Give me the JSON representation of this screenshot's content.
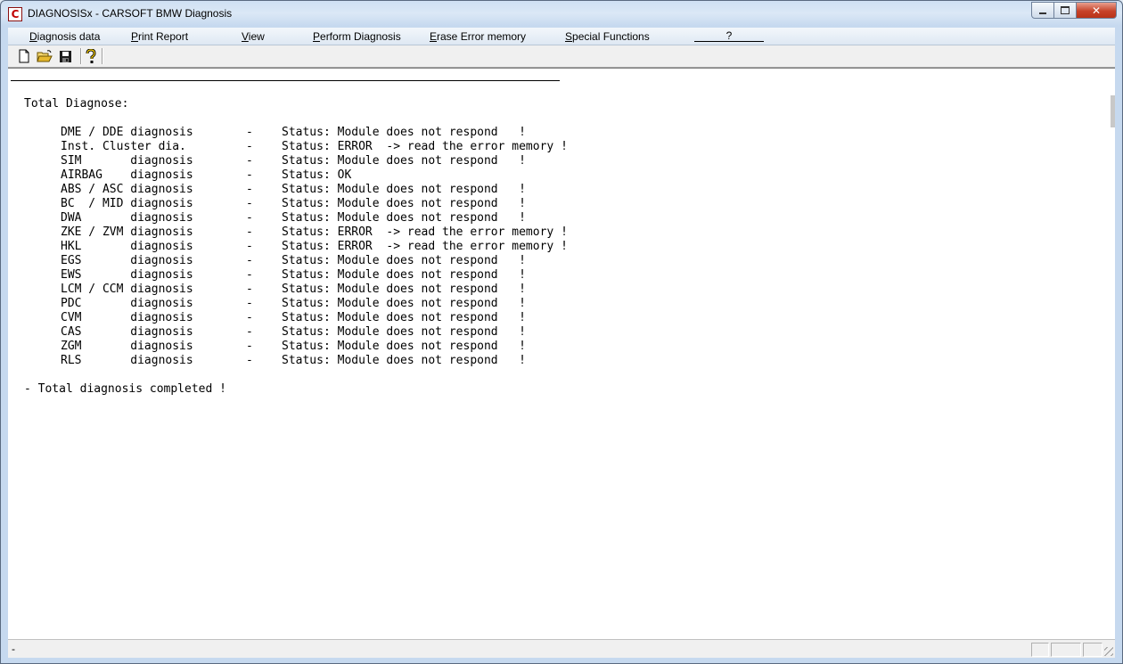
{
  "window": {
    "app_icon_letter": "C",
    "title": "DIAGNOSISx - CARSOFT BMW Diagnosis"
  },
  "menu": {
    "items": [
      {
        "label": "Diagnosis data"
      },
      {
        "label": "Print Report"
      },
      {
        "label": "View"
      },
      {
        "label": "Perform Diagnosis"
      },
      {
        "label": "Erase Error memory"
      },
      {
        "label": "Special Functions"
      },
      {
        "label": "?"
      }
    ]
  },
  "toolbar": {
    "icons": [
      "new-document-icon",
      "open-folder-icon",
      "save-disk-icon",
      "help-question-icon"
    ]
  },
  "report": {
    "heading": "Total Diagnose:",
    "rows": [
      {
        "module": "DME / DDE diagnosis",
        "dash": "-",
        "status": "Status: Module does not respond   !"
      },
      {
        "module": "Inst. Cluster dia.",
        "dash": "-",
        "status": "Status: ERROR  -> read the error memory !"
      },
      {
        "module": "SIM       diagnosis",
        "dash": "-",
        "status": "Status: Module does not respond   !"
      },
      {
        "module": "AIRBAG    diagnosis",
        "dash": "-",
        "status": "Status: OK"
      },
      {
        "module": "ABS / ASC diagnosis",
        "dash": "-",
        "status": "Status: Module does not respond   !"
      },
      {
        "module": "BC  / MID diagnosis",
        "dash": "-",
        "status": "Status: Module does not respond   !"
      },
      {
        "module": "DWA       diagnosis",
        "dash": "-",
        "status": "Status: Module does not respond   !"
      },
      {
        "module": "ZKE / ZVM diagnosis",
        "dash": "-",
        "status": "Status: ERROR  -> read the error memory !"
      },
      {
        "module": "HKL       diagnosis",
        "dash": "-",
        "status": "Status: ERROR  -> read the error memory !"
      },
      {
        "module": "EGS       diagnosis",
        "dash": "-",
        "status": "Status: Module does not respond   !"
      },
      {
        "module": "EWS       diagnosis",
        "dash": "-",
        "status": "Status: Module does not respond   !"
      },
      {
        "module": "LCM / CCM diagnosis",
        "dash": "-",
        "status": "Status: Module does not respond   !"
      },
      {
        "module": "PDC       diagnosis",
        "dash": "-",
        "status": "Status: Module does not respond   !"
      },
      {
        "module": "CVM       diagnosis",
        "dash": "-",
        "status": "Status: Module does not respond   !"
      },
      {
        "module": "CAS       diagnosis",
        "dash": "-",
        "status": "Status: Module does not respond   !"
      },
      {
        "module": "ZGM       diagnosis",
        "dash": "-",
        "status": "Status: Module does not respond   !"
      },
      {
        "module": "RLS       diagnosis",
        "dash": "-",
        "status": "Status: Module does not respond   !"
      }
    ],
    "footer": "- Total diagnosis completed !"
  },
  "statusbar": {
    "text": "-"
  }
}
